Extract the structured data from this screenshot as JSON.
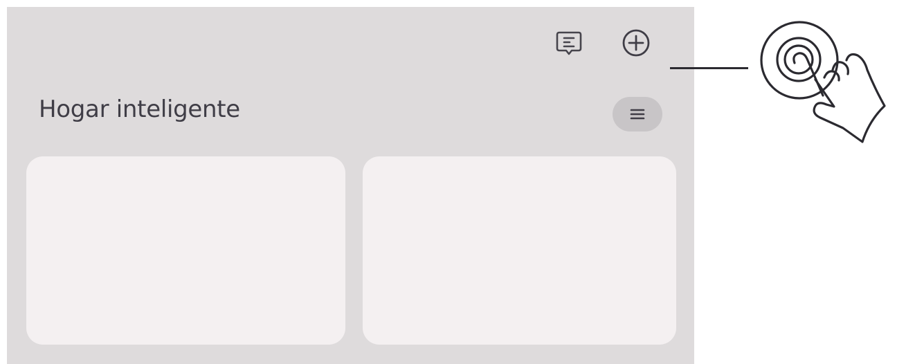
{
  "section": {
    "title": "Hogar inteligente"
  },
  "icons": {
    "message": "message-icon",
    "add": "add-circle-icon",
    "menu": "menu-icon",
    "hand": "tap-hand-icon"
  },
  "colors": {
    "panel_bg": "#dedbdc",
    "card_bg": "#f4f0f1",
    "text": "#3f3d46",
    "menu_pill_bg": "#c8c5c7"
  }
}
